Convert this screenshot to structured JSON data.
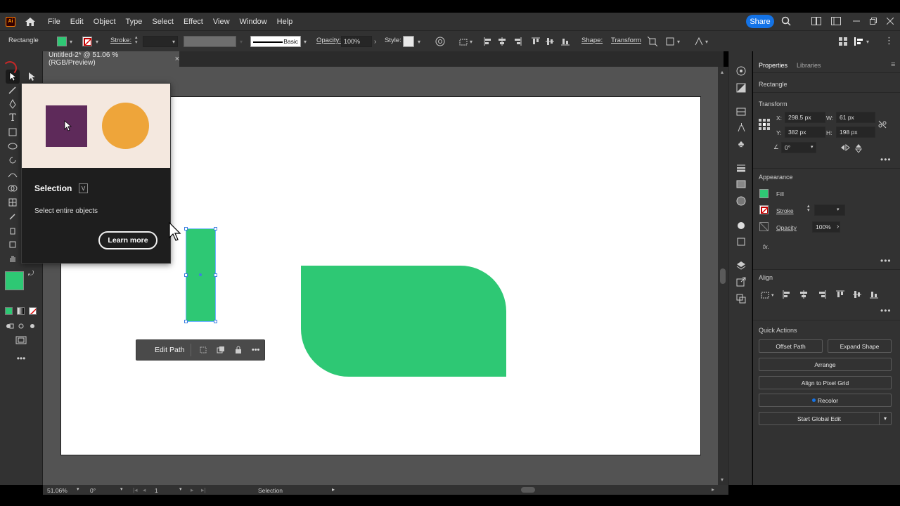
{
  "app": {
    "logo": "Ai"
  },
  "menu": {
    "items": [
      "File",
      "Edit",
      "Object",
      "Type",
      "Select",
      "Effect",
      "View",
      "Window",
      "Help"
    ],
    "share": "Share"
  },
  "control": {
    "object_type": "Rectangle",
    "stroke_label": "Stroke:",
    "brush_label": "Basic",
    "opacity_label": "Opacity:",
    "opacity_value": "100%",
    "style_label": "Style:",
    "shape_label": "Shape:",
    "transform_label": "Transform"
  },
  "document": {
    "tab_title": "Untitled-2* @ 51.06 % (RGB/Preview)",
    "close": "×"
  },
  "tooltip": {
    "title": "Selection",
    "shortcut": "V",
    "description": "Select entire objects",
    "learn_more": "Learn more"
  },
  "context_bar": {
    "edit_path": "Edit Path"
  },
  "properties": {
    "tabs": [
      "Properties",
      "Libraries"
    ],
    "object_type": "Rectangle",
    "transform": {
      "title": "Transform",
      "x_label": "X:",
      "x": "298.5 px",
      "y_label": "Y:",
      "y": "382 px",
      "w_label": "W:",
      "w": "61 px",
      "h_label": "H:",
      "h": "198 px",
      "angle": "0°"
    },
    "appearance": {
      "title": "Appearance",
      "fill": "Fill",
      "stroke": "Stroke",
      "opacity": "Opacity",
      "opacity_value": "100%",
      "fx": "fx."
    },
    "align": {
      "title": "Align"
    },
    "quick_actions": {
      "title": "Quick Actions",
      "offset_path": "Offset Path",
      "expand_shape": "Expand Shape",
      "arrange": "Arrange",
      "align_pixel": "Align to Pixel Grid",
      "recolor": "Recolor",
      "global_edit": "Start Global Edit"
    }
  },
  "status": {
    "zoom": "51.06%",
    "rotation": "0°",
    "artboard": "1",
    "tool": "Selection"
  },
  "colors": {
    "fill": "#2ec874",
    "accent": "#1473e6",
    "tooltip_square": "#5e2a5a",
    "tooltip_circle": "#eea53a"
  }
}
